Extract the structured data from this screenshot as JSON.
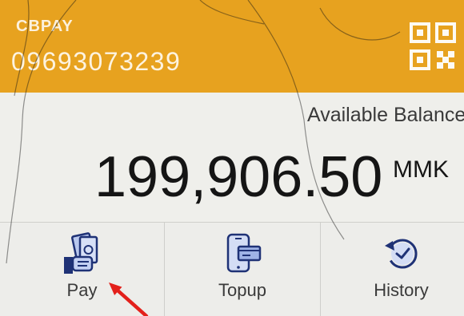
{
  "app": {
    "name": "CBPAY",
    "phone": "09693073239",
    "qr_icon": "qr-code-icon"
  },
  "balance": {
    "label": "Available Balance",
    "amount": "199,906.50",
    "currency": "MMK"
  },
  "actions": [
    {
      "label": "Pay",
      "icon": "pay-money-icon"
    },
    {
      "label": "Topup",
      "icon": "phone-topup-icon"
    },
    {
      "label": "History",
      "icon": "history-clock-icon"
    }
  ],
  "annotation": {
    "icon": "red-arrow-icon",
    "target": "Pay"
  },
  "colors": {
    "header": "#e7a21f",
    "background": "#efefeb",
    "text": "#151515",
    "icon": "#1f3276",
    "arrow": "#e3201b"
  }
}
